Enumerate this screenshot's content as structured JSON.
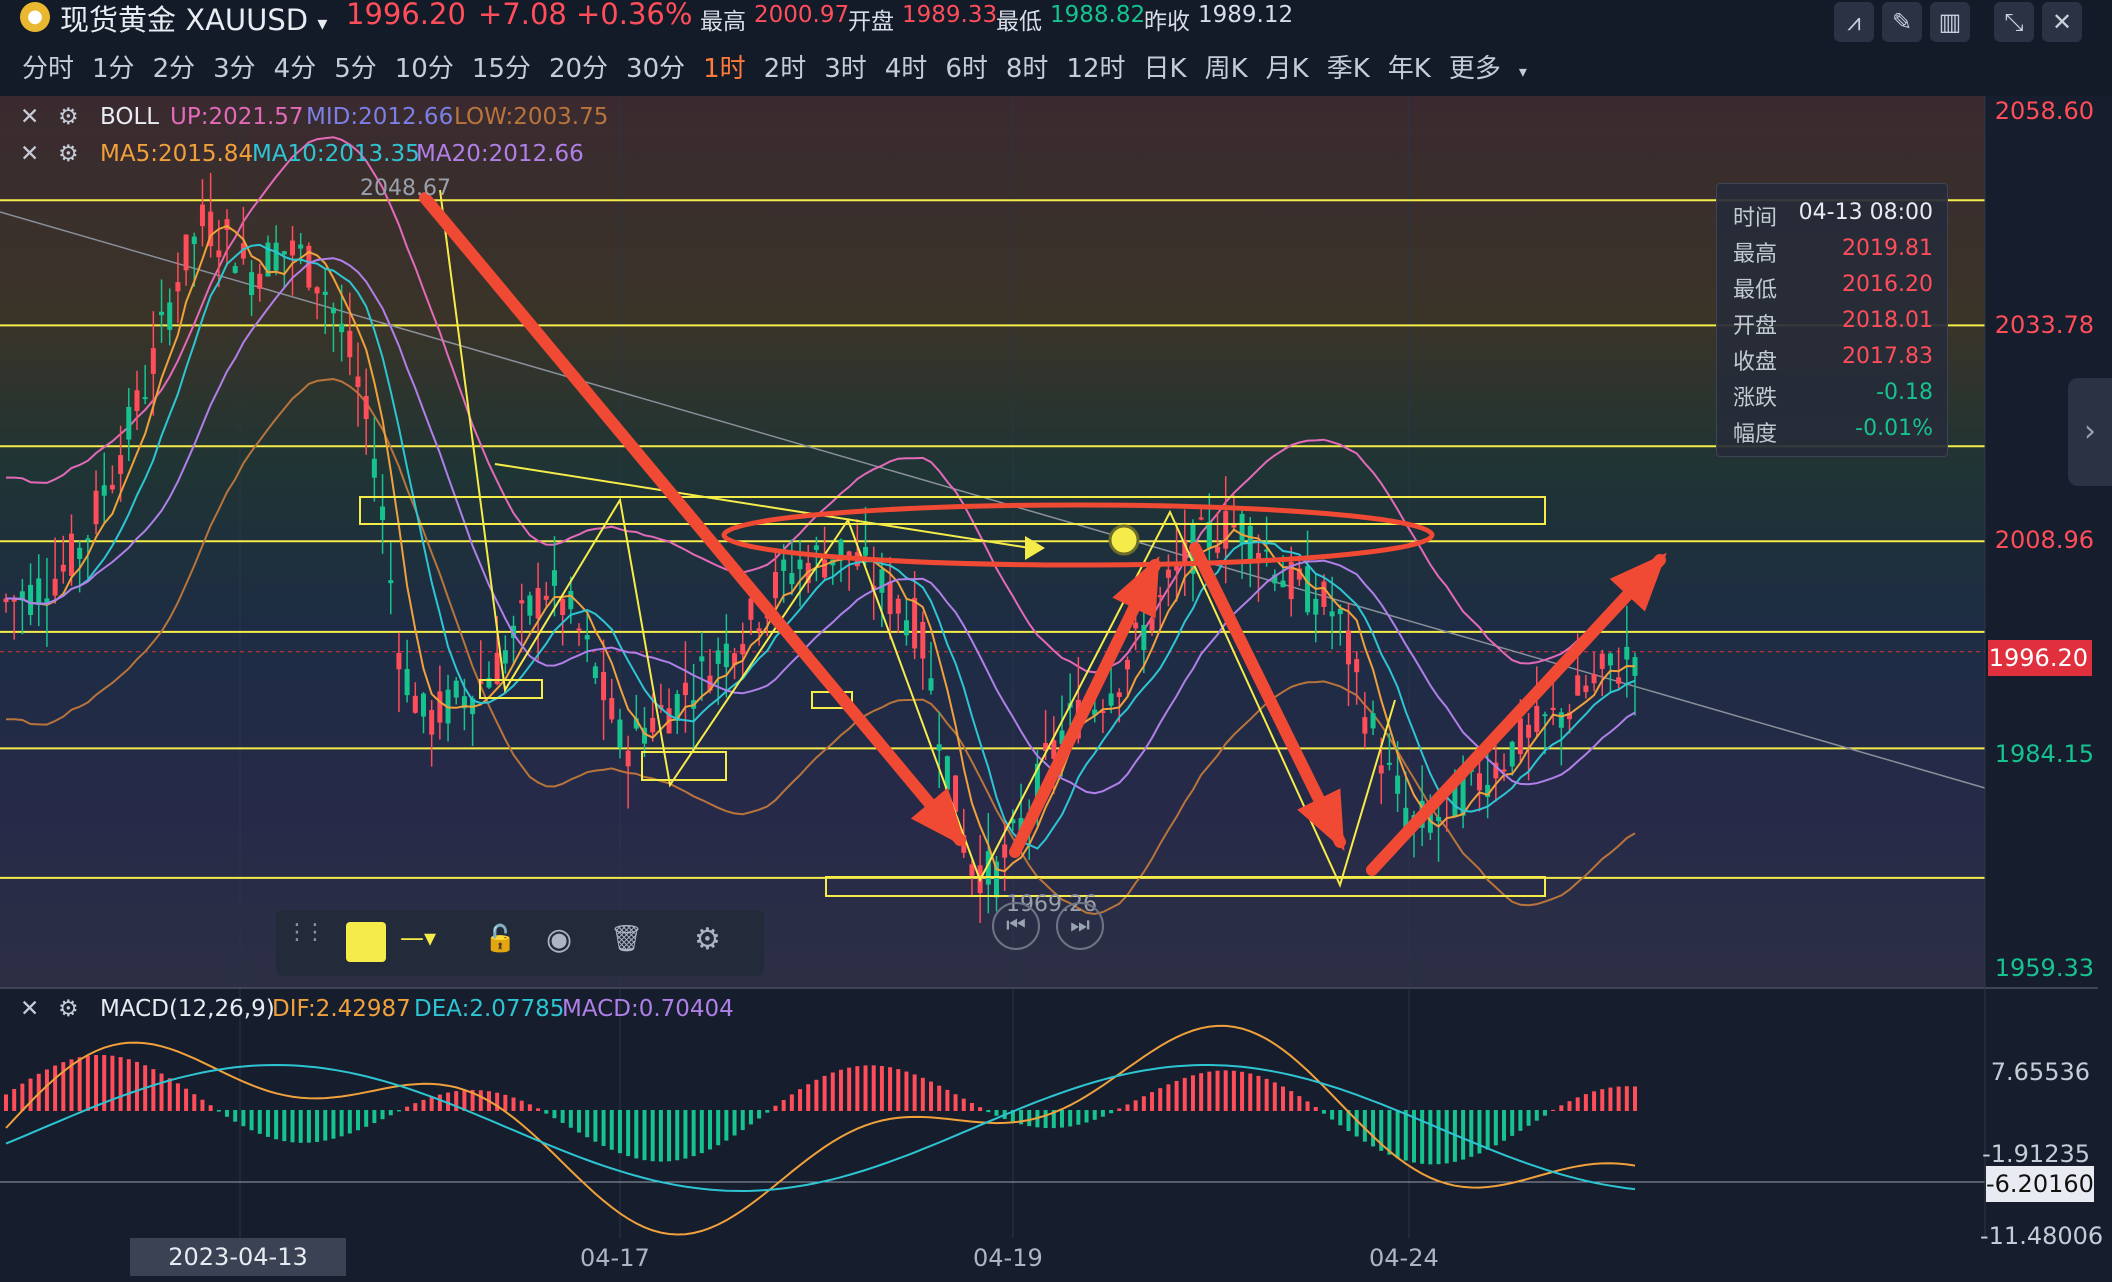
{
  "header": {
    "logo_glyph": "●",
    "title": "现货黄金 XAUUSD",
    "title_caret": "▾",
    "price": "1996.20",
    "change": "+7.08",
    "change_pct": "+0.36%",
    "high_label": "最高",
    "high_value": "2000.97",
    "open_label": "开盘",
    "open_value": "1989.33",
    "low_label": "最低",
    "low_value": "1988.82",
    "prev_close_label": "昨收",
    "prev_close_value": "1989.12",
    "tool_icons": [
      "indicator-icon",
      "pen-icon",
      "candle-type-icon",
      "collapse-icon",
      "close-icon"
    ],
    "tool_glyphs": [
      "⩘",
      "✎",
      "▥",
      "⤡",
      "✕"
    ]
  },
  "periods": {
    "items": [
      "分时",
      "1分",
      "2分",
      "3分",
      "4分",
      "5分",
      "10分",
      "15分",
      "20分",
      "30分",
      "1时",
      "2时",
      "3时",
      "4时",
      "6时",
      "8时",
      "12时",
      "日K",
      "周K",
      "月K",
      "季K",
      "年K"
    ],
    "active": "1时",
    "more_label": "更多",
    "more_caret": "▾"
  },
  "indicators": {
    "boll": {
      "name": "BOLL",
      "up": "UP:2021.57",
      "mid": "MID:2012.66",
      "low": "LOW:2003.75"
    },
    "ma": {
      "ma5": "MA5:2015.84",
      "ma10": "MA10:2013.35",
      "ma20": "MA20:2012.66"
    },
    "macd": {
      "name": "MACD(12,26,9)",
      "dif": "DIF:2.42987",
      "dea": "DEA:2.07785",
      "macd": "MACD:0.70404"
    },
    "close_glyph": "✕",
    "gear_glyph": "⚙"
  },
  "annotations": {
    "peak_price": "2048.67",
    "trough_price": "1969.26"
  },
  "tooltip": {
    "rows": [
      {
        "k": "时间",
        "v": "04-13 08:00",
        "color": "#e8ecf2"
      },
      {
        "k": "最高",
        "v": "2019.81",
        "color": "#ff4d5a"
      },
      {
        "k": "最低",
        "v": "2016.20",
        "color": "#ff4d5a"
      },
      {
        "k": "开盘",
        "v": "2018.01",
        "color": "#ff4d5a"
      },
      {
        "k": "收盘",
        "v": "2017.83",
        "color": "#ff4d5a"
      },
      {
        "k": "涨跌",
        "v": "-0.18",
        "color": "#16c38f"
      },
      {
        "k": "幅度",
        "v": "-0.01%",
        "color": "#16c38f"
      }
    ]
  },
  "price_axis": {
    "labels": [
      {
        "text": "2058.60",
        "value": 2058.6,
        "color": "#ff4d5a"
      },
      {
        "text": "2033.78",
        "value": 2033.78,
        "color": "#ff4d5a"
      },
      {
        "text": "2008.96",
        "value": 2008.96,
        "color": "#ff4d5a"
      },
      {
        "text": "1984.15",
        "value": 1984.15,
        "color": "#16c38f"
      },
      {
        "text": "1959.33",
        "value": 1959.33,
        "color": "#16c38f"
      }
    ],
    "current": "1996.20"
  },
  "macd_axis": {
    "labels": [
      "7.65536",
      "-1.91235",
      "-11.48006"
    ],
    "cursor": "-6.20160"
  },
  "time_axis": {
    "labels": [
      "04-17",
      "04-19",
      "04-24"
    ],
    "cursor": "2023-04-13 08:00"
  },
  "drawbar": {
    "icons": [
      "drag-handle-icon",
      "color-swatch-icon",
      "line-style-icon",
      "lock-icon",
      "visibility-icon",
      "delete-icon",
      "settings-icon"
    ],
    "glyphs": [
      "⋮⋮",
      "",
      "—▾",
      "🔓",
      "◉",
      "🗑",
      "⚙"
    ],
    "nav_glyphs": [
      "⏮",
      "⏭"
    ]
  },
  "scroll_glyph": "›",
  "colors": {
    "up": "#ff4d5a",
    "down": "#16c38f",
    "ma5": "#f0a13c",
    "ma10": "#2ec5d3",
    "ma20": "#b07fe8",
    "boll_up": "#e26ab8",
    "boll_mid": "#7b7fe6",
    "boll_low": "#b8743b",
    "drawing": "#f5ec4a",
    "arrow": "#f04a34",
    "macd_dif": "#f0a13c",
    "macd_dea": "#2ec5d3"
  },
  "chart_data": {
    "type": "candlestick",
    "symbol": "XAUUSD",
    "interval": "1H",
    "ylim": [
      1959.33,
      2058.6
    ],
    "xticks": [
      "04-17",
      "04-19",
      "04-24"
    ],
    "close_path": [
      2002,
      2003,
      2005,
      2008,
      2015,
      2022,
      2030,
      2040,
      2046,
      2044,
      2040,
      2043,
      2042,
      2038,
      2030,
      2018,
      1995,
      1988,
      1990,
      1992,
      1995,
      2000,
      2004,
      2000,
      1993,
      1985,
      1988,
      1990,
      1993,
      1996,
      1999,
      2003,
      2006,
      2007,
      2008,
      2005,
      2002,
      1999,
      1985,
      1972,
      1970,
      1975,
      1982,
      1988,
      1990,
      1993,
      1998,
      2003,
      2008,
      2010,
      2011,
      2008,
      2004,
      2003,
      2000,
      1990,
      1982,
      1976,
      1977,
      1980,
      1982,
      1985,
      1987,
      1989,
      1992,
      1994,
      1996
    ],
    "horizontal_levels": [
      2048.5,
      2034,
      2020,
      2009,
      1998.5,
      1985,
      1970
    ],
    "peak_price": 2048.67,
    "trough_price": 1969.26
  }
}
